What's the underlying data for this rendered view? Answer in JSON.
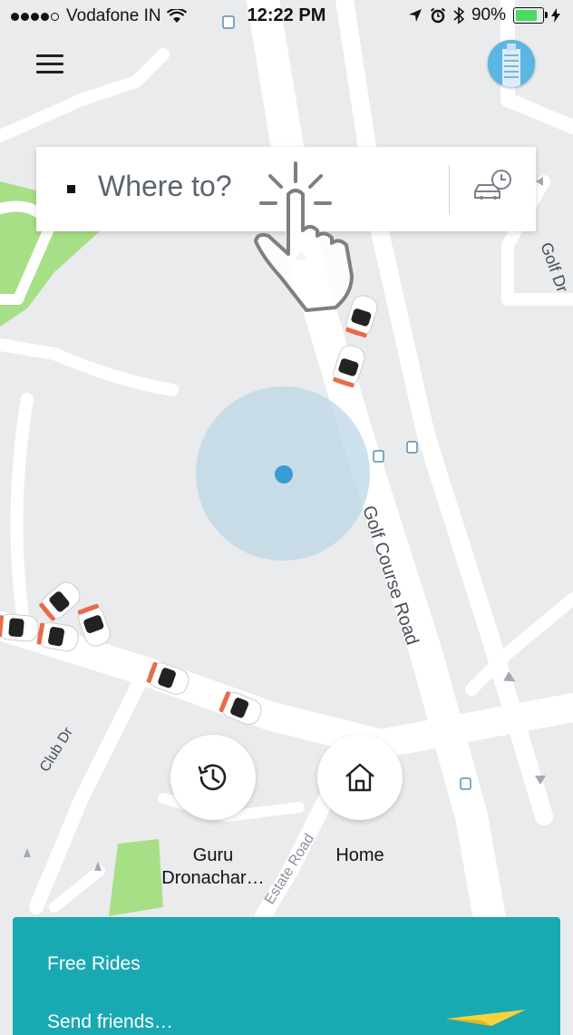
{
  "status_bar": {
    "carrier": "Vodafone IN",
    "time": "12:22 PM",
    "battery": "90%",
    "battery_level": 0.9,
    "signal_bars": 4,
    "icons": [
      "signal-dots-icon",
      "wifi-icon",
      "transit-icon",
      "location-arrow-icon",
      "alarm-icon",
      "bluetooth-icon",
      "battery-icon",
      "charging-icon"
    ]
  },
  "header": {
    "menu_icon": "hamburger-menu-icon",
    "avatar_icon": "profile-avatar-building-icon"
  },
  "search": {
    "placeholder": "Where to?",
    "schedule_icon": "scheduled-ride-car-clock-icon",
    "pointer_icon": "tap-hand-icon"
  },
  "map": {
    "road_labels": [
      "Golf Course Road",
      "Golf Dr",
      "Club Dr",
      "Estate Road"
    ],
    "colors": {
      "map_bg": "#e9ebec",
      "road": "#ffffff",
      "park": "#a7df86",
      "location_dot": "#3a9ad6",
      "accuracy_circle": "#bcd7e6"
    },
    "icons": [
      "car-icon",
      "bus-stop-icon",
      "one-way-arrow-icon",
      "current-location-dot-icon"
    ]
  },
  "shortcuts": [
    {
      "label": "Guru Dronachar…",
      "icon": "history-clock-icon"
    },
    {
      "label": "Home",
      "icon": "home-icon"
    }
  ],
  "promo": {
    "title": "Free Rides",
    "subtitle": "Send friends…",
    "color": "#19a9b3",
    "icon": "paper-plane-icon"
  }
}
